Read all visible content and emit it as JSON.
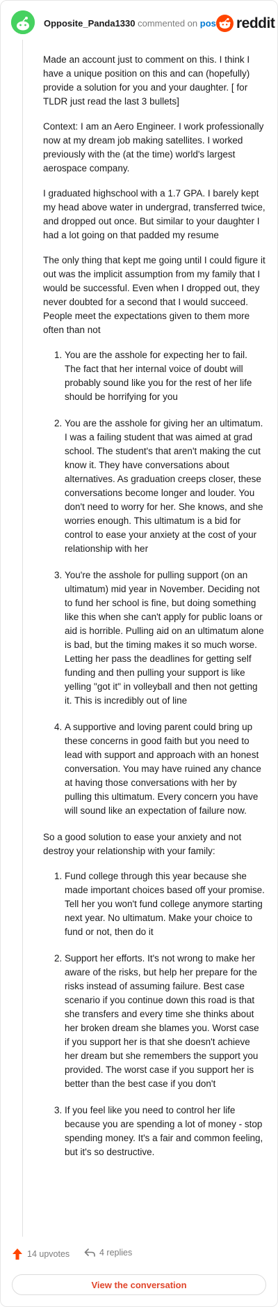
{
  "header": {
    "username": "Opposite_Panda1330",
    "action": "commented on",
    "post_link": "post",
    "logo_text": "reddit"
  },
  "colors": {
    "accent": "#ff4500",
    "link": "#0079d3",
    "avatar": "#46d160"
  },
  "comment": {
    "paragraphs_before": [
      "Made an account just to comment on this. I think I have a unique position on this and can (hopefully) provide a solution for you and your daughter. [ for TLDR just read the last 3 bullets]",
      "Context: I am an Aero Engineer. I work professionally now at my dream job making satellites. I worked previously with the (at the time) world's largest aerospace company.",
      "I graduated highschool with a 1.7 GPA. I barely kept my head above water in undergrad, transferred twice, and dropped out once. But similar to your daughter I had a lot going on that padded my resume",
      "The only thing that kept me going until I could figure it out was the implicit assumption from my family that I would be successful. Even when I dropped out, they never doubted for a second that I would succeed. People meet the expectations given to them more often than not"
    ],
    "list_one": [
      "You are the asshole for expecting her to fail. The fact that her internal voice of doubt will probably sound like you for the rest of her life should be horrifying for you",
      "You are the asshole for giving her an ultimatum. I was a failing student that was aimed at grad school. The student's that aren't making the cut know it. They have conversations about alternatives. As graduation creeps closer, these conversations become longer and louder. You don't need to worry for her. She knows, and she worries enough. This ultimatum is a bid for control to ease your anxiety at the cost of your relationship with her",
      "You're the asshole for pulling support (on an ultimatum) mid year in November. Deciding not to fund her school is fine, but doing something like this when she can't apply for public loans or aid is horrible. Pulling aid on an ultimatum alone is bad, but the timing makes it so much worse. Letting her pass the deadlines for getting self funding and then pulling your support is like yelling \"got it\" in volleyball and then not getting it. This is incredibly out of line",
      "A supportive and loving parent could bring up these concerns in good faith but you need to lead with support and approach with an honest conversation. You may have ruined any chance at having those conversations with her by pulling this ultimatum. Every concern you have will sound like an expectation of failure now."
    ],
    "paragraph_middle": "So a good solution to ease your anxiety and not destroy your relationship with your family:",
    "list_two": [
      "Fund college through this year because she made important choices based off your promise. Tell her you won't fund college anymore starting next year. No ultimatum. Make your choice to fund or not, then do it",
      "Support her efforts. It's not wrong to make her aware of the risks, but help her prepare for the risks instead of assuming failure. Best case scenario if you continue down this road is that she transfers and every time she thinks about her broken dream she blames you. Worst case if you support her is that she doesn't achieve her dream but she remembers the support you provided. The worst case if you support her is better than the best case if you don't",
      "If you feel like you need to control her life because you are spending a lot of money - stop spending money. It's a fair and common feeling, but it's so destructive."
    ]
  },
  "footer": {
    "upvotes": "14 upvotes",
    "replies": "4 replies",
    "view_button": "View the conversation"
  }
}
